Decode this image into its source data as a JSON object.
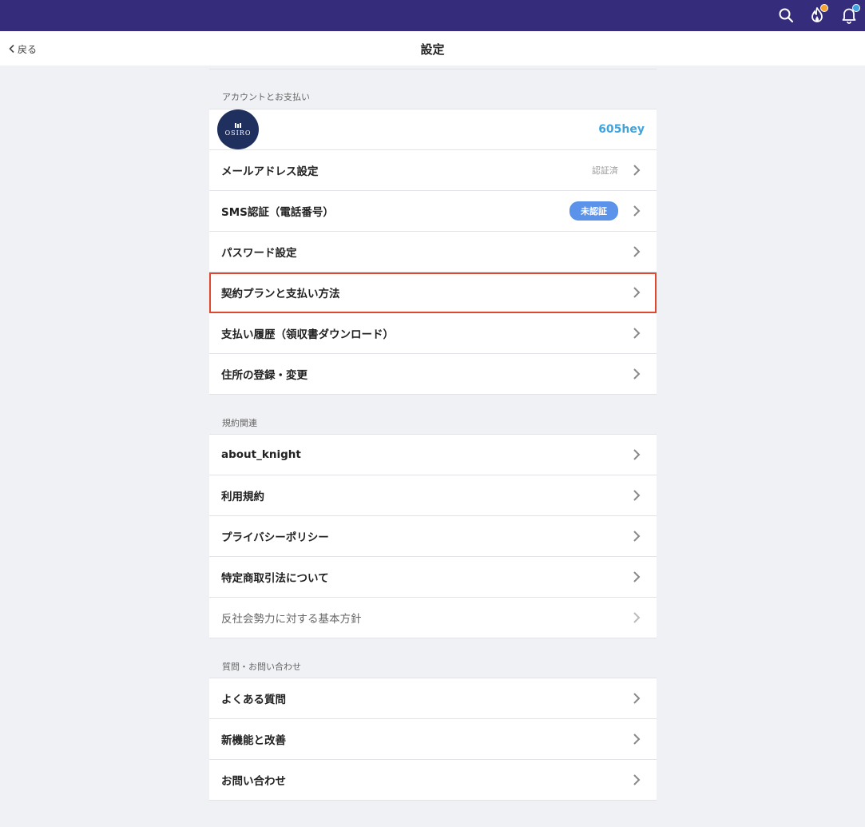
{
  "topbar": {
    "search_icon": "search-icon",
    "fire_icon": "fire-icon",
    "bell_icon": "bell-icon",
    "fire_dot_color": "#f4a22b",
    "bell_dot_color": "#3ea4df"
  },
  "nav": {
    "back_label": "戻る",
    "title": "設定"
  },
  "sections": {
    "account": {
      "header": "アカウントとお支払い",
      "profile": {
        "brand": "OSIRO",
        "username": "605hey"
      },
      "email": {
        "label": "メールアドレス設定",
        "status": "認証済"
      },
      "sms": {
        "label": "SMS認証（電話番号）",
        "badge": "未認証",
        "badge_color": "#5b93ea"
      },
      "password": {
        "label": "パスワード設定"
      },
      "plan": {
        "label": "契約プランと支払い方法"
      },
      "history": {
        "label": "支払い履歴（領収書ダウンロード）"
      },
      "address": {
        "label": "住所の登録・変更"
      }
    },
    "terms": {
      "header": "規約関連",
      "about": {
        "label": "about_knight"
      },
      "tos": {
        "label": "利用規約"
      },
      "privacy": {
        "label": "プライバシーポリシー"
      },
      "commerce": {
        "label": "特定商取引法について"
      },
      "antisocial": {
        "label": "反社会勢力に対する基本方針"
      }
    },
    "support": {
      "header": "質問・お問い合わせ",
      "faq": {
        "label": "よくある質問"
      },
      "features": {
        "label": "新機能と改善"
      },
      "contact": {
        "label": "お問い合わせ"
      }
    }
  },
  "colors": {
    "topbar_bg": "#352c7c",
    "highlight_border": "#e0472f",
    "username": "#3ea4df"
  }
}
